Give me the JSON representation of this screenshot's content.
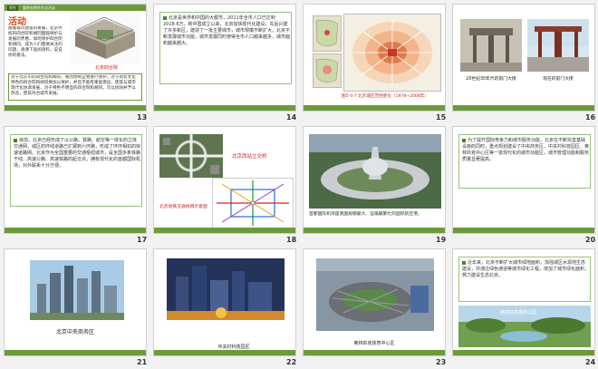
{
  "slides": [
    {
      "num": "13",
      "tag1": "探究",
      "tag2": "重视去探究文化活动",
      "title": "活动",
      "text1": "随着城市建设的发展，北京传统的四合院和胡同面临保护与发展的矛盾，如何保护四合院和胡同，成为人们需要关注的问题，请课下查阅资料，说说你的看法。",
      "label": "北京四合院",
      "text2": "对于北京市的四合院和胡同，要因地制宜地进行保护，对于具有文化特色的四合院和胡同要加以保护，并且不能有重复建设，使其与城市现代化协调发展，对于特色不明显的四合院和胡同，可以拆除并予以改造，使其符合城市发展。"
    },
    {
      "num": "14",
      "text": "北京是世界和中国的大都市，2011年全市人口已达到2018.6万，新中国成立以来，北京加快现代化建设，先后兴建了许多新区，建造了一批主要城市，城市规模不断扩大，北京不断发展城市功能，城市发展同时使得全市人口越来越多，城市面积越来越大。"
    },
    {
      "num": "15",
      "caption": "图5-4-7  北京城区范围变化（1978~2008年）"
    },
    {
      "num": "16",
      "caption1": "20世纪30年代的前门大街",
      "caption2": "现在的前门大街"
    },
    {
      "num": "17",
      "text": "目前，北京已经形成了以公路、铁路、航空等一体化的立体交通网，城区的环线道路已扩展到六环路，形成了环环相扣的快速道路网。北京作为全国重要的交通枢纽城市，是全国多条铁路干线、高速公路、高速铁路的起讫点，拥有现代化的首都国际机场，对外联系十分方便。"
    },
    {
      "num": "18",
      "label1": "北京西站立交桥",
      "label2": "北京地铁交通线网示意图"
    },
    {
      "num": "19",
      "text": "首都国际机场是我国规模最大、运输最繁忙的国际航空港。"
    },
    {
      "num": "20",
      "text": "为了提升国际竞争力和城市服务功能，北京在不断完善基础设施的同时，重点规划建设了中央商务区、中关村科技园区、奥林匹克中心区等一批现代化的城市功能区，城市管理功能和服务质量显著提高。"
    },
    {
      "num": "21",
      "caption": "北京中央商务区"
    },
    {
      "num": "22",
      "caption": "中关村科技园区"
    },
    {
      "num": "23",
      "caption": "奥林匹克体育中心区"
    },
    {
      "num": "24",
      "text": "近年来，北京不断扩大城市绿地面积，加强城区水源地生态建设，并通过绿色通道等城市绿化工程，增加了城市绿化面积，努力建设生态北京。",
      "label": "奥林匹克森林公园"
    }
  ]
}
